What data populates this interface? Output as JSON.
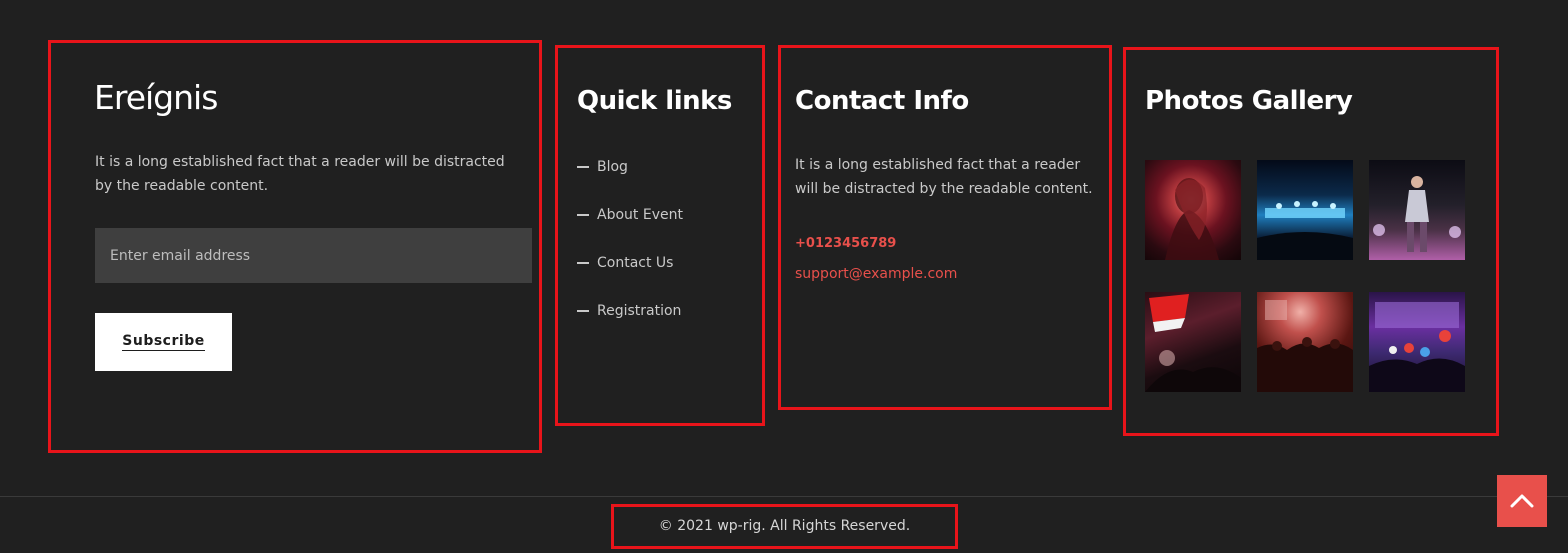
{
  "brand": {
    "logo_text": "Ereígnis",
    "description": "It is a long established fact that a reader will be distracted by the readable content.",
    "email_placeholder": "Enter email address",
    "subscribe_label": "Subscribe"
  },
  "quick_links": {
    "title": "Quick links",
    "items": [
      {
        "label": "Blog"
      },
      {
        "label": "About Event"
      },
      {
        "label": "Contact Us"
      },
      {
        "label": "Registration"
      }
    ]
  },
  "contact": {
    "title": "Contact Info",
    "description": "It is a long established fact that a reader will be distracted by the readable content.",
    "phone": "+0123456789",
    "email": "support@example.com"
  },
  "gallery": {
    "title": "Photos Gallery",
    "photos": [
      {
        "icon": "concert-singer-red-photo"
      },
      {
        "icon": "concert-stage-blue-lights-photo"
      },
      {
        "icon": "concert-performer-stage-photo"
      },
      {
        "icon": "crowd-flag-photo"
      },
      {
        "icon": "crowd-red-light-photo"
      },
      {
        "icon": "festival-crowd-purple-photo"
      }
    ]
  },
  "footer": {
    "copyright": "© 2021 wp-rig. All Rights Reserved."
  },
  "colors": {
    "background": "#202020",
    "accent": "#e8504b",
    "annotation_box": "#e8141a"
  },
  "back_to_top": {
    "icon": "chevron-up-icon"
  }
}
